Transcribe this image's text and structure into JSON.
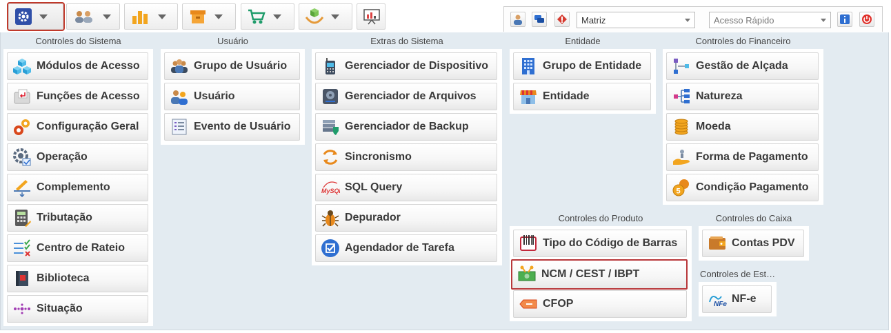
{
  "toolbar": {
    "buttons": [
      {
        "icon": "gear-icon"
      },
      {
        "icon": "users-icon"
      },
      {
        "icon": "bar-chart-icon"
      },
      {
        "icon": "box-icon"
      },
      {
        "icon": "cart-icon"
      },
      {
        "icon": "hand-box-icon"
      },
      {
        "icon": "presentation-icon"
      }
    ],
    "right": {
      "filial_value": "Matriz",
      "quick_access_placeholder": "Acesso Rápido"
    }
  },
  "groups": {
    "sistema": {
      "title": "Controles do Sistema",
      "items": [
        "Módulos de Acesso",
        "Funções de Acesso",
        "Configuração Geral",
        "Operação",
        "Complemento",
        "Tributação",
        "Centro de Rateio",
        "Biblioteca",
        "Situação"
      ]
    },
    "usuario": {
      "title": "Usuário",
      "items": [
        "Grupo de Usuário",
        "Usuário",
        "Evento de Usuário"
      ]
    },
    "extras": {
      "title": "Extras do Sistema",
      "items": [
        "Gerenciador de Dispositivo",
        "Gerenciador de Arquivos",
        "Gerenciador de Backup",
        "Sincronismo",
        "SQL Query",
        "Depurador",
        "Agendador de Tarefa"
      ]
    },
    "entidade": {
      "title": "Entidade",
      "items": [
        "Grupo de Entidade",
        "Entidade"
      ]
    },
    "financeiro": {
      "title": "Controles do Financeiro",
      "items": [
        "Gestão de Alçada",
        "Natureza",
        "Moeda",
        "Forma de Pagamento",
        "Condição Pagamento"
      ]
    },
    "produto": {
      "title": "Controles do Produto",
      "items": [
        "Tipo do Código de Barras",
        "NCM / CEST / IBPT",
        "CFOP"
      ]
    },
    "caixa": {
      "title": "Controles do Caixa",
      "items": [
        "Contas PDV"
      ]
    },
    "estoque": {
      "title": "Controles de Est…",
      "items": [
        "NF-e"
      ]
    }
  },
  "colors": {
    "panel_bg": "#e3ebf1",
    "highlight_border": "#b8373a"
  }
}
